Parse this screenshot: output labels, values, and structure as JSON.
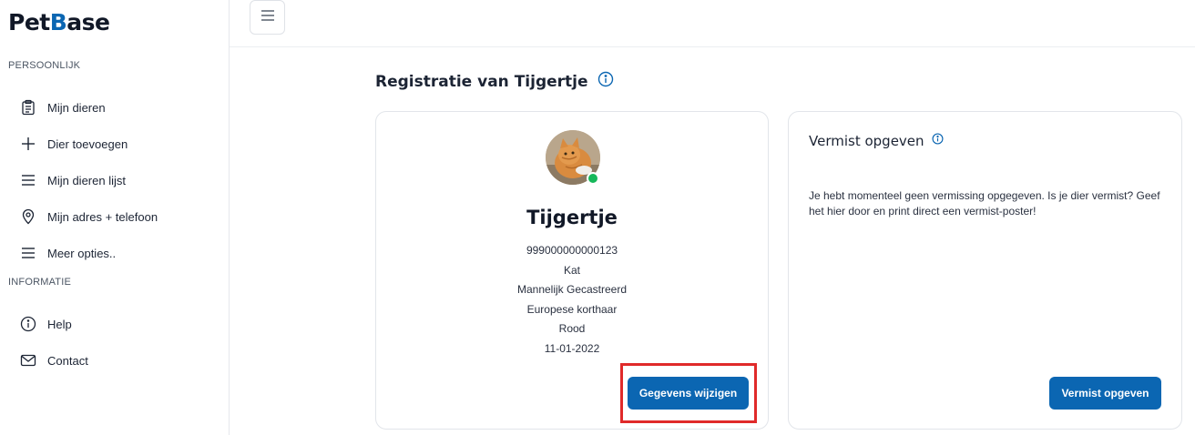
{
  "brand": {
    "logo_pre": "Pet",
    "logo_b": "B",
    "logo_post": "ase"
  },
  "sidebar": {
    "section_personal": "PERSOONLIJK",
    "section_info": "INFORMATIE",
    "items": [
      {
        "label": "Mijn dieren",
        "icon": "clipboard-icon"
      },
      {
        "label": "Dier toevoegen",
        "icon": "plus-icon"
      },
      {
        "label": "Mijn dieren lijst",
        "icon": "list-icon"
      },
      {
        "label": "Mijn adres + telefoon",
        "icon": "location-pin-icon"
      },
      {
        "label": "Meer opties..",
        "icon": "menu-lines-icon"
      },
      {
        "label": "Help",
        "icon": "info-circle-icon"
      },
      {
        "label": "Contact",
        "icon": "envelope-icon"
      }
    ]
  },
  "main": {
    "title": "Registratie van Tijgertje",
    "pet": {
      "name": "Tijgertje",
      "chip_number": "999000000000123",
      "species": "Kat",
      "gender": "Mannelijk Gecastreerd",
      "breed": "Europese korthaar",
      "color": "Rood",
      "birth_date": "11-01-2022",
      "edit_button": "Gegevens wijzigen"
    },
    "missing": {
      "title": "Vermist opgeven",
      "text": "Je hebt momenteel geen vermissing opgegeven. Is je dier vermist? Geef het hier door en print direct een vermist-poster!",
      "button": "Vermist opgeven"
    }
  },
  "colors": {
    "accent": "#0b66b2",
    "status_online": "#16b85a",
    "highlight": "#e02a2a"
  }
}
